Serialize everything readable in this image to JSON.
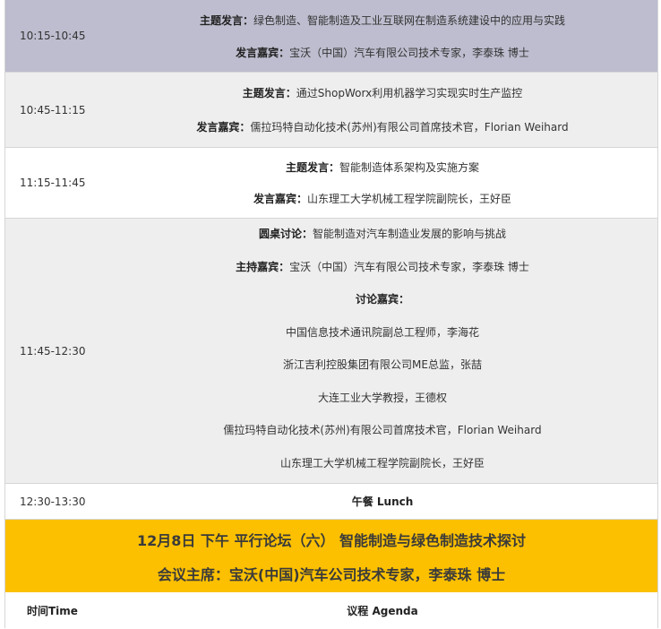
{
  "rows": [
    {
      "time": "10:15-10:45",
      "lines": [
        {
          "label": "主题发言：",
          "text": "绿色制造、智能制造及工业互联网在制造系统建设中的应用与实践"
        },
        {
          "label": "发言嘉宾：",
          "text": "宝沃（中国）汽车有限公司技术专家，李泰珠 博士"
        }
      ]
    },
    {
      "time": "10:45-11:15",
      "lines": [
        {
          "label": "主题发言：",
          "text": "通过ShopWorx利用机器学习实现实时生产监控"
        },
        {
          "label": "发言嘉宾：",
          "text": "儒拉玛特自动化技术(苏州)有限公司首席技术官，Florian Weihard"
        }
      ]
    },
    {
      "time": "11:15-11:45",
      "lines": [
        {
          "label": "主题发言：",
          "text": "智能制造体系架构及实施方案"
        },
        {
          "label": "发言嘉宾：",
          "text": "山东理工大学机械工程学院副院长，王好臣"
        }
      ]
    },
    {
      "time": "11:45-12:30",
      "lines": [
        {
          "label": "圆桌讨论：",
          "text": "智能制造对汽车制造业发展的影响与挑战"
        },
        {
          "label": "主持嘉宾：",
          "text": "宝沃（中国）汽车有限公司技术专家，李泰珠 博士"
        },
        {
          "label": "讨论嘉宾：",
          "text": ""
        },
        {
          "label": "",
          "text": "中国信息技术通讯院副总工程师，李海花"
        },
        {
          "label": "",
          "text": "浙江吉利控股集团有限公司ME总监，张喆"
        },
        {
          "label": "",
          "text": "大连工业大学教授，王德权"
        },
        {
          "label": "",
          "text": "儒拉玛特自动化技术(苏州)有限公司首席技术官，Florian Weihard"
        },
        {
          "label": "",
          "text": "山东理工大学机械工程学院副院长，王好臣"
        }
      ]
    },
    {
      "time": "12:30-13:30",
      "lines": [
        {
          "label": "午餐 Lunch",
          "text": ""
        }
      ]
    }
  ],
  "banner": {
    "line1": "12月8日 下午 平行论坛（六） 智能制造与绿色制造技术探讨",
    "line2": "会议主席：宝沃(中国)汽车公司技术专家，李泰珠 博士"
  },
  "header": {
    "time_col": "时间Time",
    "agenda_col": "议程 Agenda"
  }
}
